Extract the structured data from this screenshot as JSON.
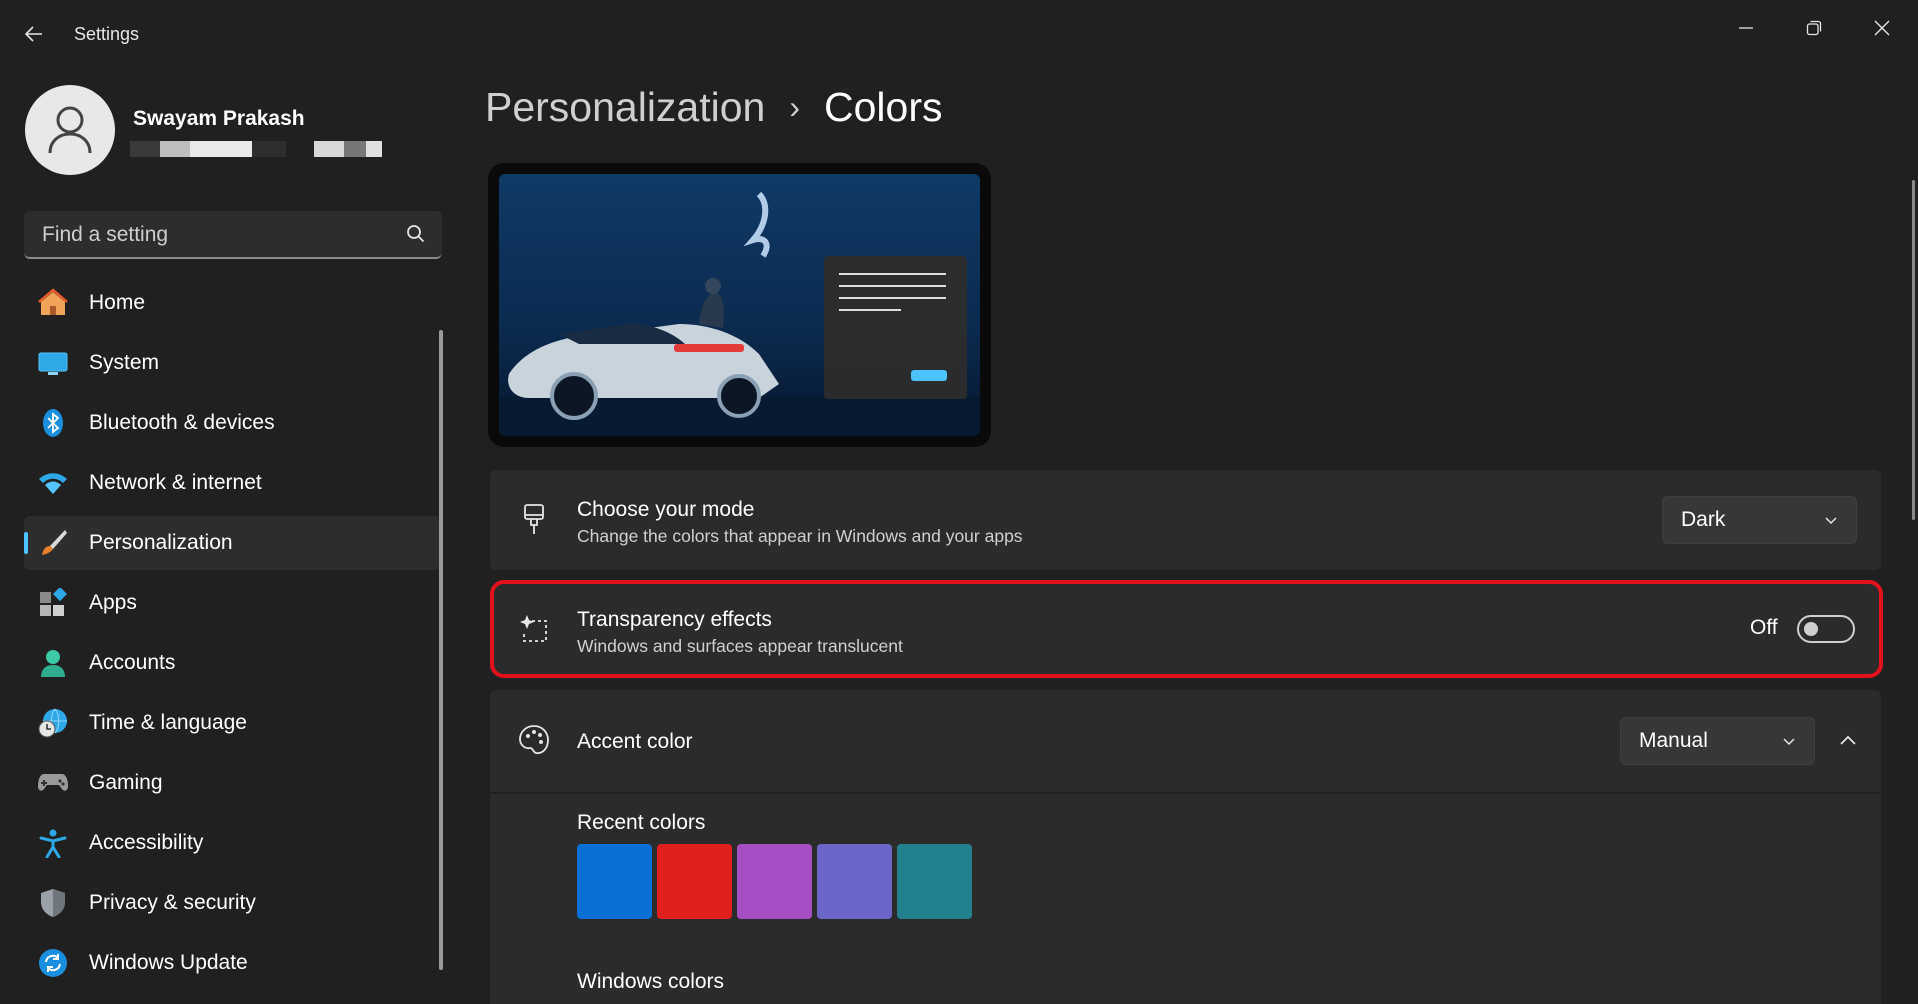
{
  "window": {
    "app_title": "Settings",
    "controls": [
      "minimize-icon",
      "maximize-icon",
      "close-icon"
    ]
  },
  "profile": {
    "name": "Swayam Prakash"
  },
  "search": {
    "placeholder": "Find a setting"
  },
  "sidebar": {
    "items": [
      {
        "label": "Home",
        "icon": "home-icon"
      },
      {
        "label": "System",
        "icon": "monitor-icon"
      },
      {
        "label": "Bluetooth & devices",
        "icon": "bluetooth-icon"
      },
      {
        "label": "Network & internet",
        "icon": "wifi-icon"
      },
      {
        "label": "Personalization",
        "icon": "paintbrush-icon",
        "selected": true
      },
      {
        "label": "Apps",
        "icon": "apps-icon"
      },
      {
        "label": "Accounts",
        "icon": "person-icon"
      },
      {
        "label": "Time & language",
        "icon": "globe-clock-icon"
      },
      {
        "label": "Gaming",
        "icon": "gamepad-icon"
      },
      {
        "label": "Accessibility",
        "icon": "accessibility-icon"
      },
      {
        "label": "Privacy & security",
        "icon": "shield-icon"
      },
      {
        "label": "Windows Update",
        "icon": "update-icon"
      }
    ],
    "accent_color": "#4cc2ff"
  },
  "header": {
    "parent": "Personalization",
    "separator": "›",
    "current": "Colors"
  },
  "mode": {
    "title": "Choose your mode",
    "subtitle": "Change the colors that appear in Windows and your apps",
    "value": "Dark"
  },
  "transparency": {
    "title": "Transparency effects",
    "subtitle": "Windows and surfaces appear translucent",
    "state_label": "Off",
    "enabled": false,
    "highlight_color": "#e3111b"
  },
  "accent": {
    "title": "Accent color",
    "value": "Manual",
    "expanded": true,
    "recent_label": "Recent colors",
    "recent_colors": [
      "#0a6fd6",
      "#e01f1f",
      "#a64fc4",
      "#6b67c8",
      "#23808f"
    ],
    "windows_colors_label": "Windows colors"
  }
}
